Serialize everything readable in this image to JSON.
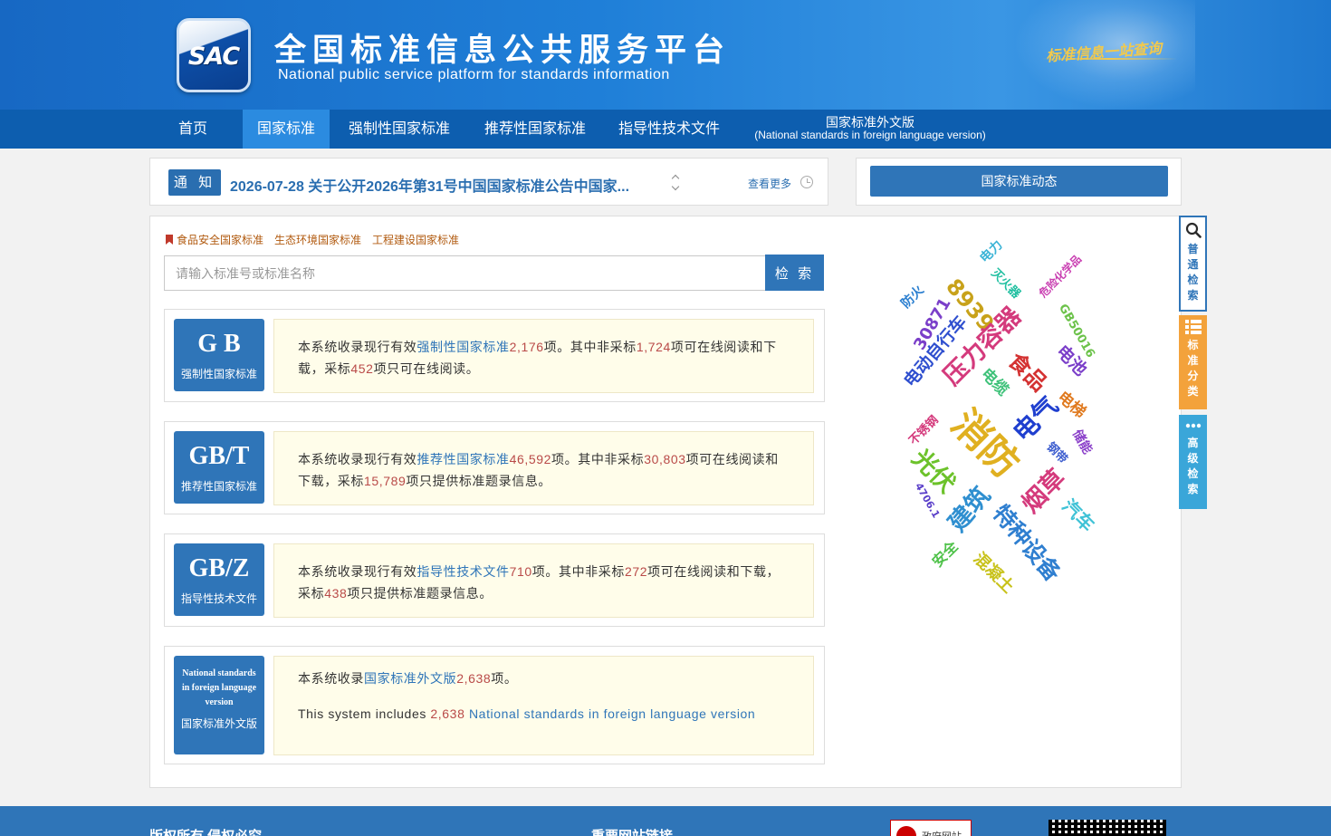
{
  "header": {
    "logo_text": "SAC",
    "title_cn": "全国标准信息公共服务平台",
    "title_en": "National public service platform  for standards information",
    "slogan": "标准信息一站查询"
  },
  "nav": {
    "items": [
      {
        "label": "首页"
      },
      {
        "label": "国家标准"
      },
      {
        "label": "强制性国家标准"
      },
      {
        "label": "推荐性国家标准"
      },
      {
        "label": "指导性技术文件"
      }
    ],
    "foreign_cn": "国家标准外文版",
    "foreign_en": "(National standards in foreign language version)"
  },
  "notice": {
    "tag": "通 知",
    "text": "2026-07-28  关于公开2026年第31号中国国家标准公告中国家...",
    "more": "查看更多"
  },
  "dynamics": {
    "label": "国家标准动态"
  },
  "categories": [
    "食品安全国家标准",
    "生态环境国家标准",
    "工程建设国家标准"
  ],
  "search": {
    "placeholder": "请输入标准号或标准名称",
    "button": "检 索"
  },
  "cards": [
    {
      "code": "G B",
      "sub": "强制性国家标准",
      "p1": "本系统收录现行有效",
      "type": "强制性国家标准",
      "total": "2,176",
      "p2": "项。其中非采标",
      "nonadopt": "1,724",
      "p3": "项可在线阅读和下载，采标",
      "adopt": "452",
      "p4": "项只可在线阅读。"
    },
    {
      "code": "GB/T",
      "sub": "推荐性国家标准",
      "p1": "本系统收录现行有效",
      "type": "推荐性国家标准",
      "total": "46,592",
      "p2": "项。其中非采标",
      "nonadopt": "30,803",
      "p3": "项可在线阅读和下载，采标",
      "adopt": "15,789",
      "p4": "项只提供标准题录信息。"
    },
    {
      "code": "GB/Z",
      "sub": "指导性技术文件",
      "p1": "本系统收录现行有效",
      "type": "指导性技术文件",
      "total": "710",
      "p2": "项。其中非采标",
      "nonadopt": "272",
      "p3": "项可在线阅读和下载，采标",
      "adopt": "438",
      "p4": "项只提供标准题录信息。"
    }
  ],
  "foreign_card": {
    "en_badge": "National standards in foreign language version",
    "sub": "国家标准外文版",
    "p1": "本系统收录",
    "type": "国家标准外文版",
    "total": "2,638",
    "p2": "项。",
    "en_p1": "This system includes ",
    "en_total": "2,638",
    "en_type": "National standards in foreign language version"
  },
  "word_cloud": [
    {
      "text": "电力",
      "color": "#3cb4d6"
    },
    {
      "text": "灭火器",
      "color": "#1fbfa0"
    },
    {
      "text": "危险化学品",
      "color": "#c93fb1"
    },
    {
      "text": "防火",
      "color": "#2b7fd0"
    },
    {
      "text": "8939",
      "color": "#c8a21a"
    },
    {
      "text": "30871",
      "color": "#7b3fc9"
    },
    {
      "text": "GB50016",
      "color": "#6cc24a"
    },
    {
      "text": "电动自行车",
      "color": "#2f4fcf"
    },
    {
      "text": "压力容器",
      "color": "#d43a7c"
    },
    {
      "text": "电池",
      "color": "#7b3fc9"
    },
    {
      "text": "食品",
      "color": "#d43232"
    },
    {
      "text": "电缆",
      "color": "#3fc27a"
    },
    {
      "text": "电梯",
      "color": "#e07a1f"
    },
    {
      "text": "不锈钢",
      "color": "#d43a7c"
    },
    {
      "text": "电气",
      "color": "#1f3fcf"
    },
    {
      "text": "消防",
      "color": "#e0b020"
    },
    {
      "text": "储能",
      "color": "#8a3fc9"
    },
    {
      "text": "钢带",
      "color": "#3f5fcf"
    },
    {
      "text": "光伏",
      "color": "#6cc22a"
    },
    {
      "text": "4706.1",
      "color": "#5a3fc9"
    },
    {
      "text": "建筑",
      "color": "#2f8fd0"
    },
    {
      "text": "烟草",
      "color": "#d43a7c"
    },
    {
      "text": "汽车",
      "color": "#3fc2d6"
    },
    {
      "text": "特种设备",
      "color": "#2f7fd0"
    },
    {
      "text": "安全",
      "color": "#4fc24a"
    },
    {
      "text": "混凝土",
      "color": "#c8c21a"
    }
  ],
  "side_tabs": [
    {
      "label": "普通检索",
      "icon": "search-icon"
    },
    {
      "label": "标准分类",
      "icon": "list-icon"
    },
    {
      "label": "高级检索",
      "icon": "more-dots-icon"
    }
  ],
  "footer": {
    "copyright": "版权所有 侵权必究",
    "links": "重要网站链接",
    "gov_badge": "政府网站"
  },
  "colors": {
    "primary": "#2f75b8",
    "nav_bg": "#0d5eaf",
    "active_nav": "#2b8be0",
    "highlight": "#b94a48",
    "desc_bg": "#fffdea"
  }
}
